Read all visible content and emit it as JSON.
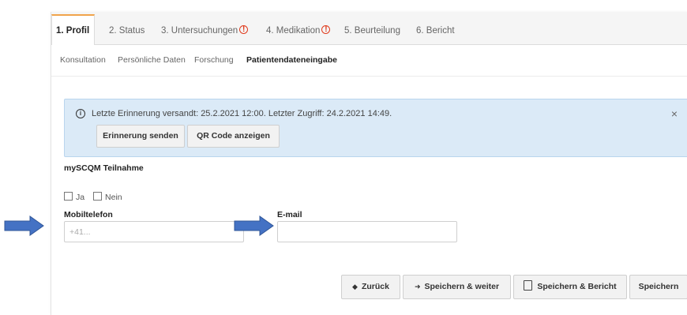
{
  "tabs": [
    {
      "label": "1. Profil",
      "active": true,
      "warning": false
    },
    {
      "label": "2. Status",
      "active": false,
      "warning": false
    },
    {
      "label": "3. Untersuchungen",
      "active": false,
      "warning": true
    },
    {
      "label": "4. Medikation",
      "active": false,
      "warning": true
    },
    {
      "label": "5. Beurteilung",
      "active": false,
      "warning": false
    },
    {
      "label": "6. Bericht",
      "active": false,
      "warning": false
    }
  ],
  "subnav": [
    {
      "label": "Konsultation",
      "active": false
    },
    {
      "label": "Persönliche Daten",
      "active": false
    },
    {
      "label": "Forschung",
      "active": false
    },
    {
      "label": "Patientendateneingabe",
      "active": true
    }
  ],
  "alert": {
    "text": "Letzte Erinnerung versandt: 25.2.2021 12:00. Letzter Zugriff: 24.2.2021 14:49.",
    "close": "×",
    "send_button": "Erinnerung senden",
    "qr_button": "QR Code anzeigen"
  },
  "participation": {
    "label": "mySCQM Teilnahme",
    "yes": "Ja",
    "no": "Nein"
  },
  "mobile": {
    "label": "Mobiltelefon",
    "placeholder": "+41...",
    "value": ""
  },
  "email": {
    "label": "E-mail",
    "placeholder": "",
    "value": ""
  },
  "actions": {
    "back": "Zurück",
    "save_next": "Speichern & weiter",
    "save_report": "Speichern & Bericht",
    "save": "Speichern"
  },
  "colors": {
    "tab_accent": "#f0a44b",
    "warning": "#e03b1d",
    "alert_bg": "#dbeaf7",
    "annotation_arrow": "#2f5597"
  }
}
